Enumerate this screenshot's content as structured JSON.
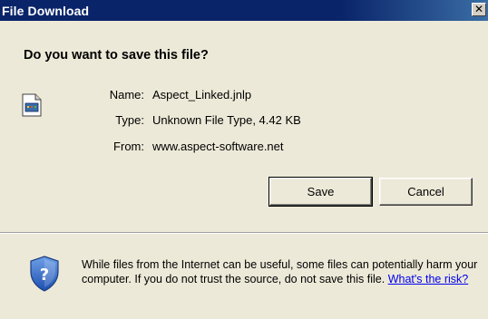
{
  "window": {
    "title": "File Download",
    "close_glyph": "✕"
  },
  "dialog": {
    "question": "Do you want to save this file?",
    "file_icon": "file-icon",
    "name_label": "Name:",
    "name_value": "Aspect_Linked.jnlp",
    "type_label": "Type:",
    "type_value": "Unknown File Type, 4.42 KB",
    "from_label": "From:",
    "from_value": "www.aspect-software.net"
  },
  "buttons": {
    "save": "Save",
    "cancel": "Cancel"
  },
  "warning": {
    "icon": "shield-icon",
    "text": "While files from the Internet can be useful, some files can potentially harm your computer. If you do not trust the source, do not save this file. ",
    "link_text": "What's the risk?"
  },
  "colors": {
    "titlebar": "#0a246a",
    "dialog_bg": "#ece9d8",
    "link": "#0000ee"
  }
}
